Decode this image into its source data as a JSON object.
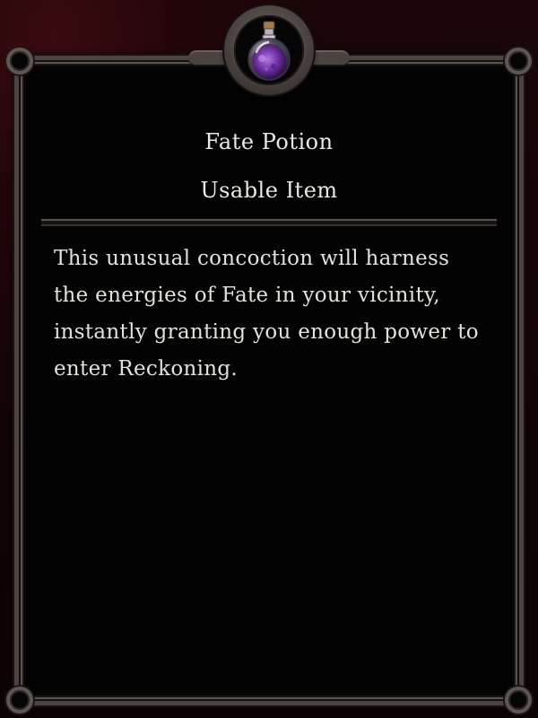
{
  "item": {
    "name": "Fate Potion",
    "type": "Usable Item",
    "description": "This unusual concoction will harness the energies of Fate in your vicinity, instantly granting you enough power to enter Reckoning.",
    "icon": "potion-flask-icon"
  },
  "colors": {
    "text": "#ebe7e1",
    "frame": "#4a4340",
    "panel_background": "#030303",
    "potion_liquid": "#7a3ab0"
  }
}
